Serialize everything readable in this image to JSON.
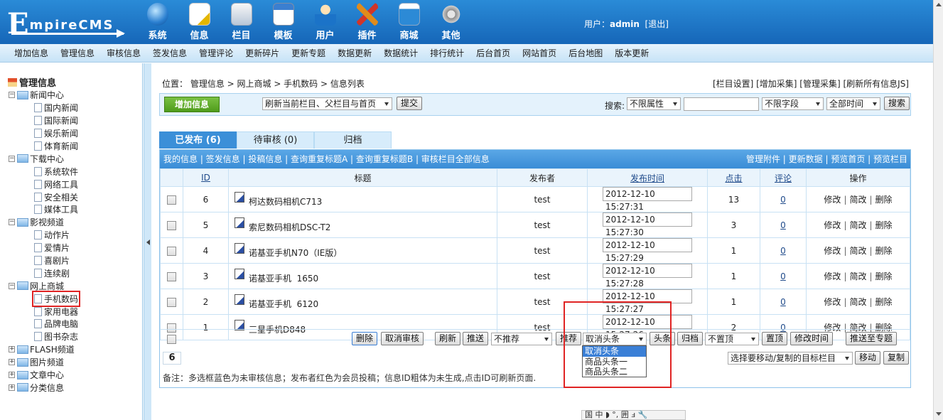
{
  "logo": {
    "first": "E",
    "rest": "mpireCMS"
  },
  "main_menu": [
    {
      "label": "系统",
      "icon": "globe-icon"
    },
    {
      "label": "信息",
      "icon": "document-icon"
    },
    {
      "label": "栏目",
      "icon": "folder-icon"
    },
    {
      "label": "模板",
      "icon": "window-icon"
    },
    {
      "label": "用户",
      "icon": "user-icon"
    },
    {
      "label": "插件",
      "icon": "tools-icon"
    },
    {
      "label": "商城",
      "icon": "store-icon"
    },
    {
      "label": "其他",
      "icon": "gear-icon"
    }
  ],
  "user": {
    "prefix": "用户：",
    "name": "admin",
    "logout": "[退出]"
  },
  "submenu": [
    "增加信息",
    "管理信息",
    "审核信息",
    "签发信息",
    "管理评论",
    "更新碎片",
    "更新专题",
    "数据更新",
    "数据统计",
    "排行统计",
    "后台首页",
    "网站首页",
    "后台地图",
    "版本更新"
  ],
  "sidebar": {
    "title": "管理信息",
    "tree": [
      {
        "label": "新闻中心",
        "expanded": true,
        "children": [
          "国内新闻",
          "国际新闻",
          "娱乐新闻",
          "体育新闻"
        ]
      },
      {
        "label": "下载中心",
        "expanded": true,
        "children": [
          "系统软件",
          "网络工具",
          "安全相关",
          "媒体工具"
        ]
      },
      {
        "label": "影视频道",
        "expanded": true,
        "children": [
          "动作片",
          "爱情片",
          "喜剧片",
          "连续剧"
        ]
      },
      {
        "label": "网上商城",
        "expanded": true,
        "children": [
          "手机数码",
          "家用电器",
          "品牌电脑",
          "图书杂志"
        ]
      },
      {
        "label": "FLASH频道",
        "expanded": false,
        "children": []
      },
      {
        "label": "图片频道",
        "expanded": false,
        "children": []
      },
      {
        "label": "文章中心",
        "expanded": false,
        "children": []
      },
      {
        "label": "分类信息",
        "expanded": false,
        "children": []
      }
    ]
  },
  "breadcrumb": "位置： 管理信息 > 网上商城 > 手机数码 > 信息列表",
  "top_links": "[栏目设置] [增加采集] [管理采集] [刷新所有信息JS]",
  "toolbar": {
    "add_button": "增加信息",
    "refresh_select": "刷新当前栏目、父栏目与首页",
    "submit": "提交",
    "search_label": "搜索:",
    "attr_select": "不限属性",
    "search_value": "",
    "field_select": "不限字段",
    "time_select": "全部时间",
    "search_button": "搜索"
  },
  "tabs": [
    {
      "label": "已发布 (6)",
      "active": true
    },
    {
      "label": "待审核 (0)",
      "active": false
    },
    {
      "label": "归档",
      "active": false
    }
  ],
  "panel_head": {
    "left": "我的信息 | 签发信息 | 投稿信息 | 查询重复标题A | 查询重复标题B | 审核栏目全部信息",
    "right": "管理附件 | 更新数据 | 预览首页 | 预览栏目"
  },
  "table": {
    "headers": {
      "id": "ID",
      "title": "标题",
      "publisher": "发布者",
      "time": "发布时间",
      "clicks": "点击",
      "comments": "评论",
      "ops": "操作"
    },
    "rows": [
      {
        "id": "6",
        "title": "柯达数码相机C713",
        "publisher": "test",
        "time": "2012-12-10 15:27:31",
        "clicks": "13",
        "comments": "0"
      },
      {
        "id": "5",
        "title": "索尼数码相机DSC-T2",
        "publisher": "test",
        "time": "2012-12-10 15:27:30",
        "clicks": "3",
        "comments": "0"
      },
      {
        "id": "4",
        "title": "诺基亚手机N70（IE版）",
        "publisher": "test",
        "time": "2012-12-10 15:27:29",
        "clicks": "1",
        "comments": "0"
      },
      {
        "id": "3",
        "title": "诺基亚手机  1650",
        "publisher": "test",
        "time": "2012-12-10 15:27:28",
        "clicks": "1",
        "comments": "0"
      },
      {
        "id": "2",
        "title": "诺基亚手机  6120",
        "publisher": "test",
        "time": "2012-12-10 15:27:27",
        "clicks": "1",
        "comments": "0"
      },
      {
        "id": "1",
        "title": "三星手机D848",
        "publisher": "test",
        "time": "2012-12-10 15:27:26",
        "clicks": "2",
        "comments": "0"
      }
    ],
    "ops": {
      "edit": "修改",
      "quick_edit": "简改",
      "delete": "删除"
    }
  },
  "bottom_actions": {
    "delete": "删除",
    "cancel_review": "取消审核",
    "refresh": "刷新",
    "push": "推送",
    "recommend_select": "不推荐",
    "recommend_btn": "推荐",
    "headline_select": "取消头条",
    "headline_btn": "头条",
    "archive": "归档",
    "top_select": "不置顶",
    "top_btn": "置顶",
    "modify_time": "修改时间",
    "push_topic": "推送至专题"
  },
  "headline_options": [
    "取消头条",
    "商品头条一",
    "商品头条二"
  ],
  "page_number": "6",
  "move_select": "选择要移动/复制的目标栏目",
  "move_btn": "移动",
  "copy_btn": "复制",
  "note": "备注：多选框蓝色为未审核信息；发布者红色为会员投稿；信息ID粗体为未生成,点击ID可刷新页面.",
  "ime_bar": "国 中 ◗ °, 囲 ⅎ 🔧"
}
